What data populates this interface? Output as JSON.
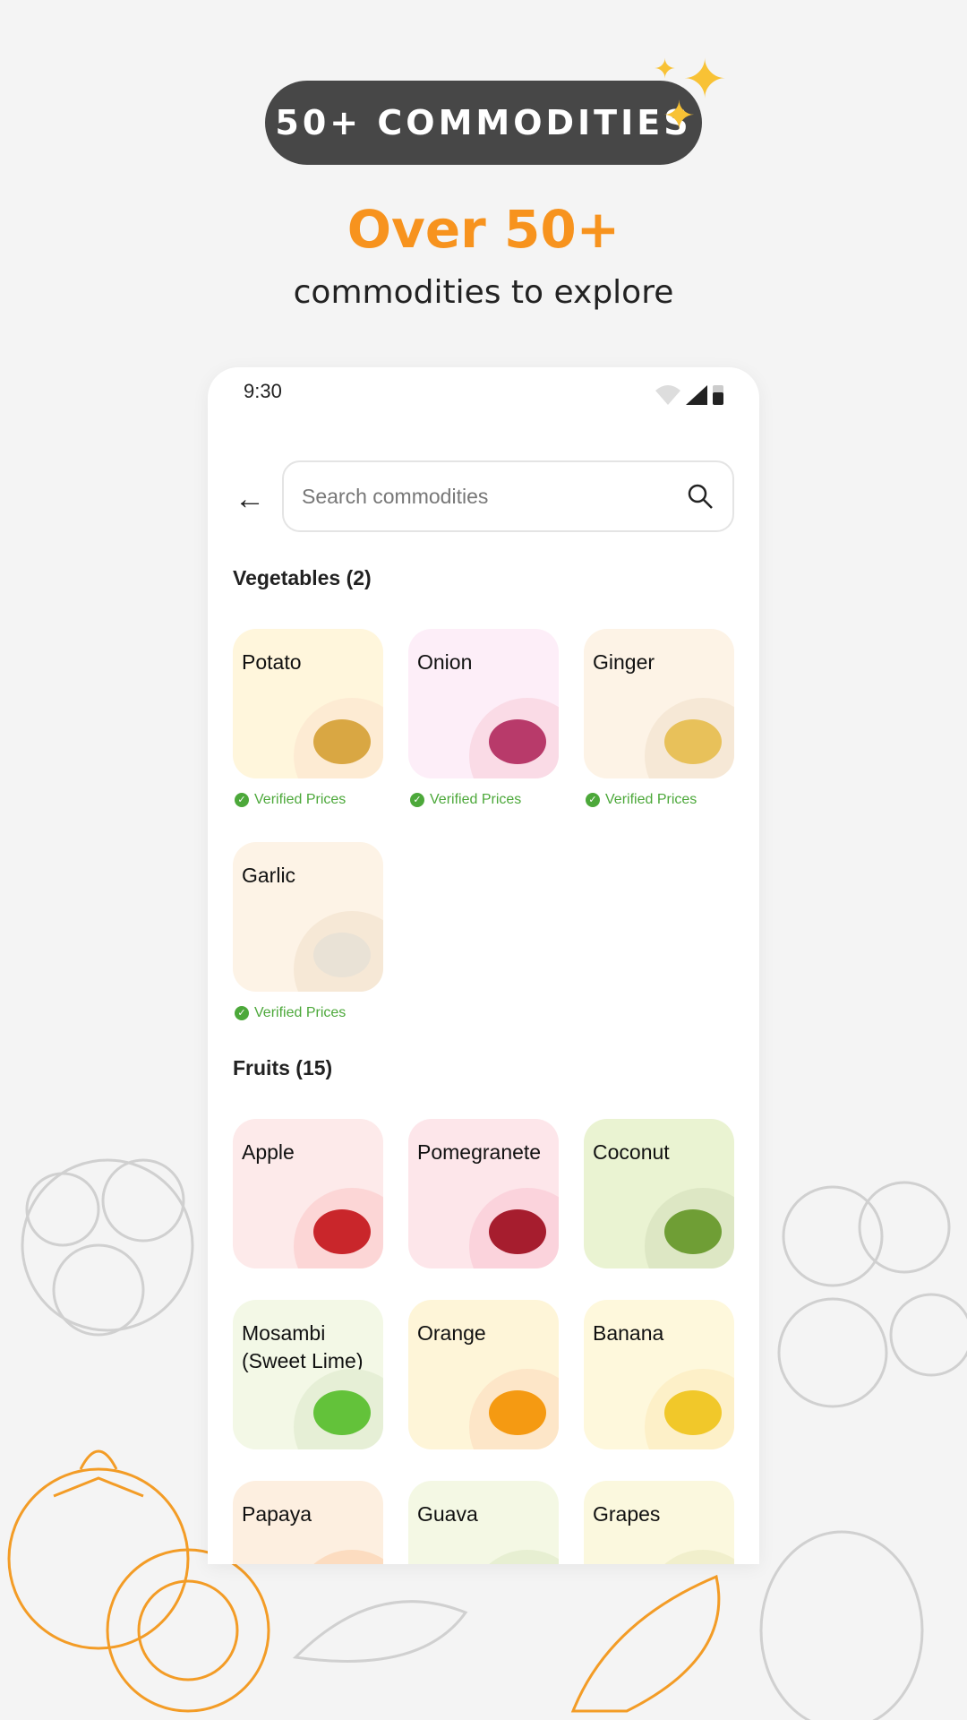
{
  "badge": "50+ COMMODITIES",
  "headline": "Over 50+",
  "subheadline": "commodities to explore",
  "status": {
    "time": "9:30"
  },
  "search": {
    "placeholder": "Search commodities"
  },
  "verified_label": "Verified Prices",
  "sections": [
    {
      "title": "Vegetables (2)",
      "items": [
        {
          "name": "Potato",
          "bg": "#fff6dc",
          "blob": "#fdebd3",
          "fruit": "#d9a743"
        },
        {
          "name": "Onion",
          "bg": "#fdeef8",
          "blob": "#fadbe6",
          "fruit": "#b83a6a"
        },
        {
          "name": "Ginger",
          "bg": "#fdf3e6",
          "blob": "#f6e8d6",
          "fruit": "#e8c15a"
        },
        {
          "name": "Garlic",
          "bg": "#fdf3e6",
          "blob": "#f6e8d6",
          "fruit": "#e9e2d6"
        }
      ]
    },
    {
      "title": "Fruits (15)",
      "items": [
        {
          "name": "Apple",
          "bg": "#fdeaea",
          "blob": "#fcd6d6",
          "fruit": "#c9262b"
        },
        {
          "name": "Pomegranete",
          "bg": "#fde6ea",
          "blob": "#fbd3dc",
          "fruit": "#a61d2e"
        },
        {
          "name": "Coconut",
          "bg": "#eaf3d2",
          "blob": "#dde7c4",
          "fruit": "#6f9e35"
        },
        {
          "name": "Mosambi (Sweet Lime)",
          "bg": "#f3f8e6",
          "blob": "#e6efd6",
          "fruit": "#63c23a"
        },
        {
          "name": "Orange",
          "bg": "#fef5d8",
          "blob": "#fde6c8",
          "fruit": "#f59a12"
        },
        {
          "name": "Banana",
          "bg": "#fef8dc",
          "blob": "#fdf0c8",
          "fruit": "#f1c82a"
        },
        {
          "name": "Papaya",
          "bg": "#fdefe0",
          "blob": "#fcdcc0",
          "fruit": "#f08a3a"
        },
        {
          "name": "Guava",
          "bg": "#f4f8e4",
          "blob": "#e7efd2",
          "fruit": "#86b540"
        },
        {
          "name": "Grapes",
          "bg": "#fbf8de",
          "blob": "#f1efcc",
          "fruit": "#8fb540"
        }
      ]
    }
  ],
  "colors": {
    "accent": "#f7931e",
    "verified": "#4ca83a",
    "badge_bg": "#474747"
  }
}
